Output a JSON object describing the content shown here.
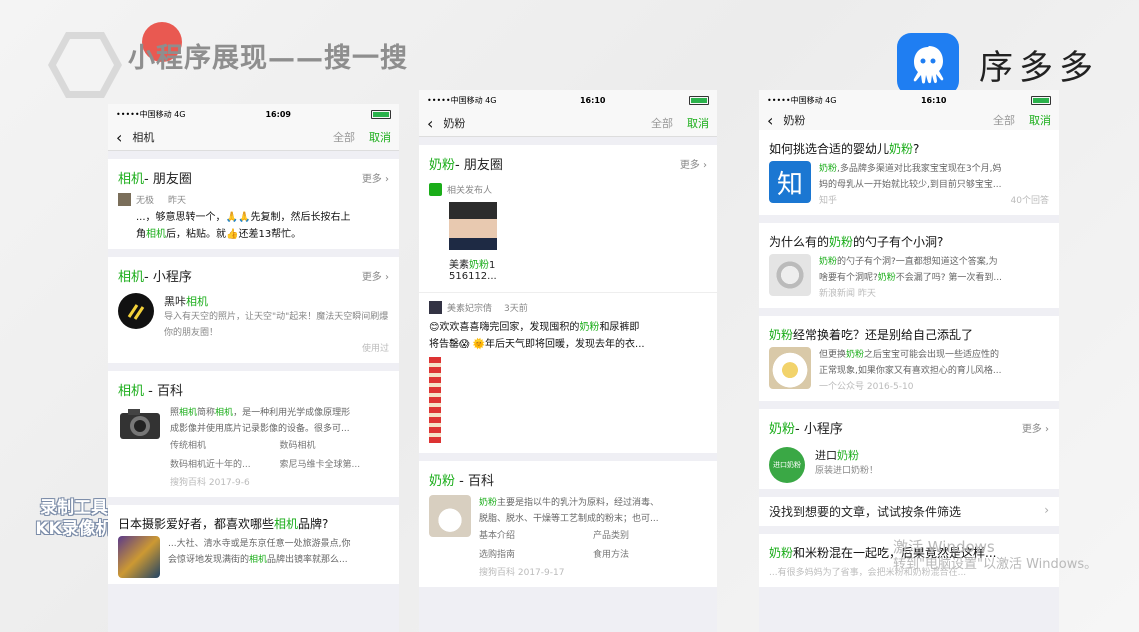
{
  "slide_title": "小程序展现——搜一搜",
  "brand": {
    "name": "序多多",
    "color": "#1f7ef2"
  },
  "watermark": {
    "line1": "录制工具",
    "line2": "KK录像机"
  },
  "windows_notice": {
    "line1": "激活 Windows",
    "line2": "转到\"电脑设置\"以激活 Windows。"
  },
  "phone1": {
    "status": {
      "carrier": "•••••中国移动  4G",
      "time": "16:09"
    },
    "query": "相机",
    "filter": "全部",
    "cancel": "取消",
    "moments": {
      "kw": "相机",
      "rest": "- 朋友圈",
      "more": "更多 ›",
      "user": "无极",
      "time": "昨天",
      "line1": "...，够意思转一个，🙏🙏先复制，然后长按右上",
      "line2a": "角",
      "line2kw": "相机",
      "line2b": "后，粘贴。就👍还差13帮忙。"
    },
    "mini": {
      "kw": "相机",
      "rest": "- 小程序",
      "more": "更多 ›",
      "name_a": "黑咔",
      "name_kw": "相机",
      "desc": "导入有天空的照片，让天空\"动\"起来！魔法天空瞬间刷爆你的朋友圈！",
      "used": "使用过"
    },
    "baike": {
      "kw": "相机",
      "rest": " - 百科",
      "d1": "照",
      "d1kw": "相机",
      "d2": "简称",
      "d2kw": "相机",
      "d3": "，是一种利用光学成像原理形",
      "d4": "成影像并使用底片记录影像的设备。很多可...",
      "links": [
        "传统相机",
        "数码相机",
        "数码相机近十年的...",
        "索尼马维卡全球第..."
      ],
      "footer": "搜狗百科 2017-9-6"
    },
    "article": {
      "t1": "日本摄影爱好者，都喜欢哪些",
      "tkw": "相机",
      "t2": "品牌?",
      "l1": "...大社、清水寺或是东京任意一处旅游景点,你",
      "l2a": "会惊讶地发现满街的",
      "l2kw": "相机",
      "l2b": "品牌出镜率就那么..."
    }
  },
  "phone2": {
    "status": {
      "carrier": "•••••中国移动  4G",
      "time": "16:10"
    },
    "query": "奶粉",
    "filter": "全部",
    "cancel": "取消",
    "moments": {
      "kw": "奶粉",
      "rest": "- 朋友圈",
      "more": "更多 ›",
      "related": "相关发布人",
      "pub_name_a": "美素",
      "pub_name_kw": "奶粉",
      "pub_name_b": "1",
      "pub_num": "516112...",
      "user": "美素妃宗倩",
      "time": "3天前",
      "l1a": "😊欢欢喜喜嗨完回家，发现囤积的",
      "l1kw": "奶粉",
      "l1b": "和尿裤即",
      "l2": "将告罄😱 🌞年后天气即将回暖，发现去年的衣..."
    },
    "baike": {
      "kw": "奶粉",
      "rest": " - 百科",
      "d1kw": "奶粉",
      "d1": "主要是指以牛的乳汁为原料，经过消毒、",
      "d2": "脱脂、脱水、干燥等工艺制成的粉末；也可...",
      "links": [
        "基本介绍",
        "产品类别",
        "选购指南",
        "食用方法"
      ],
      "footer": "搜狗百科 2017-9-17"
    }
  },
  "phone3": {
    "status": {
      "carrier": "•••••中国移动  4G",
      "time": "16:10"
    },
    "query": "奶粉",
    "filter": "全部",
    "cancel": "取消",
    "a1": {
      "t1": "如何挑选合适的婴幼儿",
      "tkw": "奶粉",
      "t2": "?",
      "icon": "知",
      "d1kw": "奶粉",
      "d1": ",多品牌多渠道对比我家宝宝现在3个月,妈",
      "d2": "妈的母乳从一开始就比较少,到目前只够宝宝...",
      "src": "知乎",
      "count": "40个回答"
    },
    "a2": {
      "t1": "为什么有的",
      "tkw": "奶粉",
      "t2": "的勺子有个小洞?",
      "d1kw": "奶粉",
      "d1": "的勺子有个洞?一直都想知道这个答案,为",
      "d2a": "啥要有个洞呢?",
      "d2kw": "奶粉",
      "d2b": "不会漏了吗? 第一次看到...",
      "src": "新浪新闻 昨天"
    },
    "a3": {
      "tkw": "奶粉",
      "t1": "经常换着吃？还是别给自己添乱了",
      "d1a": "但更换",
      "d1kw": "奶粉",
      "d1b": "之后宝宝可能会出现一些适应性的",
      "d2": "正常现象,如果你家又有喜欢担心的育儿风格...",
      "src": "一个公众号 2016-5-10"
    },
    "mini": {
      "kw": "奶粉",
      "rest": "- 小程序",
      "more": "更多 ›",
      "name_a": "进口",
      "name_kw": "奶粉",
      "desc": "原装进口奶粉！",
      "logo": "进口奶粉"
    },
    "notfound": "没找到想要的文章，试试按条件筛选",
    "a4": {
      "tkw": "奶粉",
      "t1": "和米粉混在一起吃，后果竟然是这样...",
      "d": "...有很多妈妈为了省事，会把米粉和奶粉混合在..."
    }
  }
}
